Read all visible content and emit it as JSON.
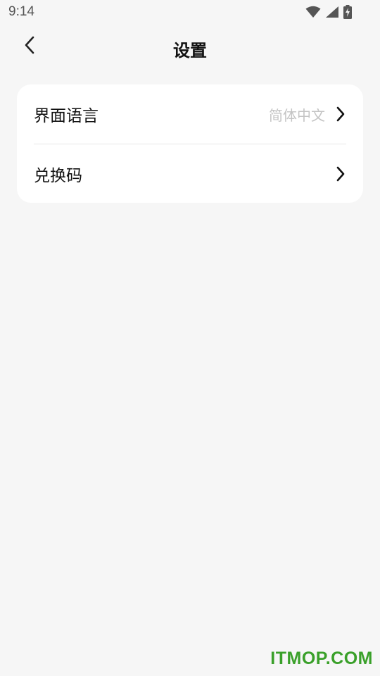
{
  "status_bar": {
    "time": "9:14",
    "icons": [
      "wifi-icon",
      "cellular-signal-icon",
      "battery-charging-icon"
    ]
  },
  "header": {
    "title": "设置",
    "back_icon": "chevron-left-icon"
  },
  "settings": {
    "items": [
      {
        "label": "界面语言",
        "value": "简体中文",
        "icon": "chevron-right-icon"
      },
      {
        "label": "兑换码",
        "value": "",
        "icon": "chevron-right-icon"
      }
    ]
  },
  "watermark": {
    "text": "ITMOP.COM",
    "color": "#3aa02a"
  },
  "colors": {
    "background": "#f6f6f6",
    "card": "#ffffff",
    "secondary_text": "#c4c4c4",
    "divider": "#e6e6e6"
  }
}
